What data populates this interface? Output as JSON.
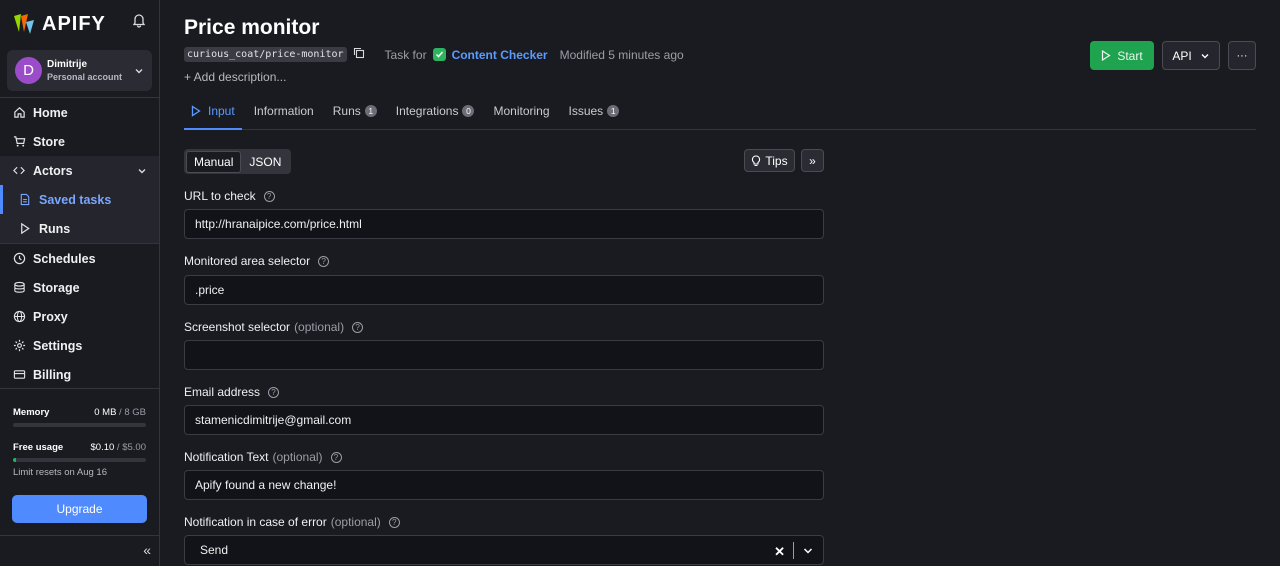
{
  "brand": {
    "name": "APIFY"
  },
  "account": {
    "initial": "D",
    "name": "Dimitrije",
    "type": "Personal account"
  },
  "nav": {
    "home": "Home",
    "store": "Store",
    "actors": "Actors",
    "saved_tasks": "Saved tasks",
    "runs": "Runs",
    "schedules": "Schedules",
    "storage": "Storage",
    "proxy": "Proxy",
    "settings": "Settings",
    "billing": "Billing"
  },
  "usage": {
    "memory_label": "Memory",
    "memory_used": "0 MB",
    "memory_total": " / 8 GB",
    "memory_fraction": 0,
    "free_label": "Free usage",
    "free_used": "$0.10",
    "free_total": " / $5.00",
    "free_fraction": 0.02,
    "reset_text": "Limit resets on Aug 16",
    "upgrade_label": "Upgrade"
  },
  "page": {
    "title": "Price monitor",
    "slug": "curious_coat/price-monitor",
    "task_for": "Task for",
    "actor_name": "Content Checker",
    "modified": "Modified 5 minutes ago",
    "add_description": "+ Add description..."
  },
  "actions": {
    "start": "Start",
    "api": "API",
    "more": "···"
  },
  "tabs": [
    {
      "label": "Input",
      "count": ""
    },
    {
      "label": "Information",
      "count": ""
    },
    {
      "label": "Runs",
      "count": "1"
    },
    {
      "label": "Integrations",
      "count": "0"
    },
    {
      "label": "Monitoring",
      "count": ""
    },
    {
      "label": "Issues",
      "count": "1"
    }
  ],
  "editor": {
    "manual": "Manual",
    "json": "JSON",
    "tips": "Tips"
  },
  "fields": {
    "url": {
      "label": "URL to check",
      "value": "http://hranaipice.com/price.html"
    },
    "area": {
      "label": "Monitored area selector",
      "value": ".price"
    },
    "screenshot": {
      "label": "Screenshot selector",
      "optional": "(optional)",
      "value": ""
    },
    "email": {
      "label": "Email address",
      "value": "stamenicdimitrije@gmail.com"
    },
    "notification": {
      "label": "Notification Text",
      "optional": "(optional)",
      "value": "Apify found a new change!"
    },
    "error": {
      "label": "Notification in case of error",
      "optional": "(optional)",
      "value": "Send"
    }
  },
  "colors": {
    "accent": "#4f8bff",
    "start": "#1fa34e",
    "avatar": "#9b4dc9"
  }
}
